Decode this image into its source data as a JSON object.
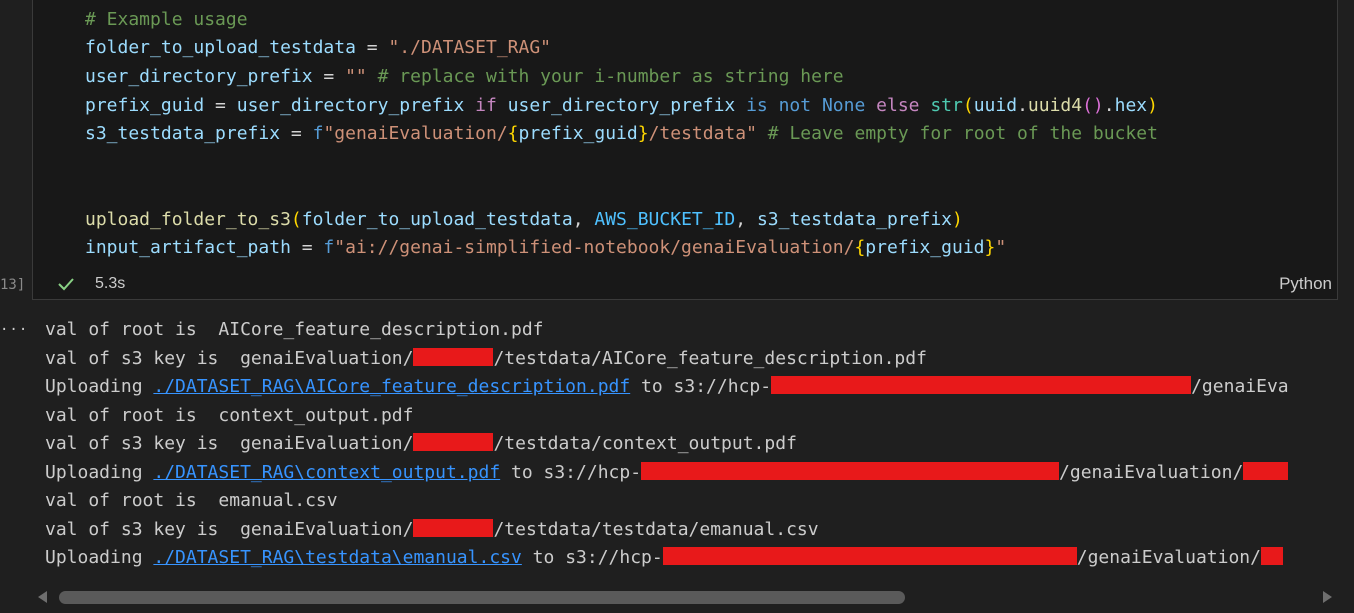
{
  "code": {
    "comment_example": "# Example usage",
    "l2_var": "folder_to_upload_testdata",
    "l2_eq": " = ",
    "l2_str": "\"./DATASET_RAG\"",
    "l3_var": "user_directory_prefix",
    "l3_eq": " = ",
    "l3_str": "\"\"",
    "l3_comment": " # replace with your i-number as string here",
    "l4_var": "prefix_guid",
    "l4_eq": " = ",
    "l4_var2": "user_directory_prefix",
    "l4_if": " if ",
    "l4_var3": "user_directory_prefix",
    "l4_is": " is not ",
    "l4_none": "None",
    "l4_else": " else ",
    "l4_str_fn": "str",
    "l4_p1": "(",
    "l4_uuid": "uuid",
    "l4_dot1": ".",
    "l4_uuid4": "uuid4",
    "l4_p2": "()",
    "l4_dot2": ".",
    "l4_hex": "hex",
    "l4_p3": ")",
    "l5_var": "s3_testdata_prefix",
    "l5_eq": " = ",
    "l5_f": "f",
    "l5_s1": "\"genaiEvaluation/",
    "l5_b1": "{",
    "l5_v": "prefix_guid",
    "l5_b2": "}",
    "l5_s2": "/testdata\"",
    "l5_comment": " # Leave empty for root of the bucket",
    "l8_fn": "upload_folder_to_s3",
    "l8_p1": "(",
    "l8_a1": "folder_to_upload_testdata",
    "l8_c1": ", ",
    "l8_a2": "AWS_BUCKET_ID",
    "l8_c2": ", ",
    "l8_a3": "s3_testdata_prefix",
    "l8_p2": ")",
    "l9_var": "input_artifact_path",
    "l9_eq": " = ",
    "l9_f": "f",
    "l9_s1": "\"ai://genai-simplified-notebook/genaiEvaluation/",
    "l9_b1": "{",
    "l9_v": "prefix_guid",
    "l9_b2": "}",
    "l9_s2": "\""
  },
  "cell_footer": {
    "exec_count": "13]",
    "time": "5.3s",
    "language": "Python"
  },
  "output": {
    "dots": "...",
    "o1": "val of root is  AICore_feature_description.pdf",
    "o2a": "val of s3 key is  genaiEvaluation/",
    "o2b": "/testdata/AICore_feature_description.pdf",
    "o3a": "Uploading ",
    "o3link": "./DATASET_RAG\\AICore_feature_description.pdf",
    "o3b": " to s3://hcp-",
    "o3c": "/genaiEva",
    "o4": "val of root is  context_output.pdf",
    "o5a": "val of s3 key is  genaiEvaluation/",
    "o5b": "/testdata/context_output.pdf",
    "o6a": "Uploading ",
    "o6link": "./DATASET_RAG\\context_output.pdf",
    "o6b": " to s3://hcp-",
    "o6c": "/genaiEvaluation/",
    "o7": "val of root is  emanual.csv",
    "o8a": "val of s3 key is  genaiEvaluation/",
    "o8b": "/testdata/testdata/emanual.csv",
    "o9a": "Uploading ",
    "o9link": "./DATASET_RAG\\testdata\\emanual.csv",
    "o9b": " to s3://hcp-",
    "o9c": "/genaiEvaluation/"
  },
  "colors": {
    "redaction": "#e8191a",
    "link": "#3794ff",
    "background": "#1f1f1f"
  },
  "icons": [
    "check-icon",
    "scroll-left-arrow-icon",
    "scroll-right-arrow-icon"
  ]
}
